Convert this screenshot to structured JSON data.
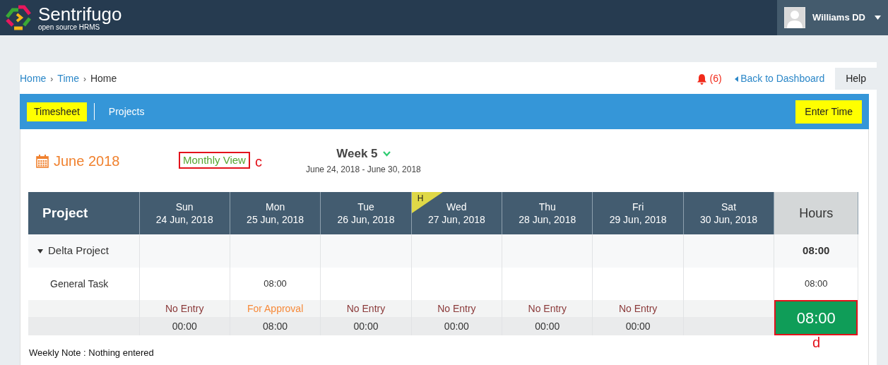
{
  "header": {
    "brand": "Sentrifugo",
    "tagline": "open source HRMS",
    "user": "Williams DD"
  },
  "breadcrumb": [
    {
      "label": "Home",
      "link": true
    },
    {
      "separator": "›",
      "label": "Time",
      "link": true
    },
    {
      "separator": "›",
      "label": "Home",
      "link": false
    }
  ],
  "notifications": "(6)",
  "back_link": "Back to Dashboard",
  "help": "Help",
  "tabs": [
    {
      "label": "Timesheet",
      "selected": true
    },
    {
      "label": "Projects",
      "selected": false
    }
  ],
  "enter_time": "Enter Time",
  "month": "June 2018",
  "monthly_view": {
    "label": "Monthly View",
    "annotation": "c"
  },
  "week": {
    "label": "Week 5",
    "range": "June 24, 2018 - June 30, 2018"
  },
  "table": {
    "project_heading": "Project",
    "hours_heading": "Hours",
    "days": [
      {
        "day": "Sun",
        "date": "24 Jun, 2018",
        "holiday": false,
        "status": "No Entry",
        "color": "#8b3a3a",
        "total": "00:00"
      },
      {
        "day": "Mon",
        "date": "25 Jun, 2018",
        "holiday": false,
        "status": "For Approval",
        "color": "#f78a3a",
        "total": "08:00"
      },
      {
        "day": "Tue",
        "date": "26 Jun, 2018",
        "holiday": false,
        "status": "No Entry",
        "color": "#8b3a3a",
        "total": "00:00"
      },
      {
        "day": "Wed",
        "date": "27 Jun, 2018",
        "holiday": true,
        "holiday_label": "H",
        "status": "No Entry",
        "color": "#8b3a3a",
        "total": "00:00"
      },
      {
        "day": "Thu",
        "date": "28 Jun, 2018",
        "holiday": false,
        "status": "No Entry",
        "color": "#8b3a3a",
        "total": "00:00"
      },
      {
        "day": "Fri",
        "date": "29 Jun, 2018",
        "holiday": false,
        "status": "No Entry",
        "color": "#8b3a3a",
        "total": "00:00"
      },
      {
        "day": "Sat",
        "date": "30 Jun, 2018",
        "holiday": false
      }
    ],
    "projects": [
      {
        "name": "Delta Project",
        "expanded": true,
        "total": "08:00",
        "tasks": [
          {
            "name": "General Task",
            "cells": [
              {
                "entry": false
              },
              {
                "entry": true,
                "value": "08:00"
              },
              {
                "entry": false
              },
              {
                "entry": false
              },
              {
                "entry": false
              },
              {
                "entry": false
              },
              {
                "entry": false
              }
            ],
            "total": "08:00"
          }
        ]
      }
    ],
    "grand_total": {
      "value": "08:00",
      "annotation": "d"
    }
  },
  "weekly_note": "Weekly Note : Nothing entered"
}
